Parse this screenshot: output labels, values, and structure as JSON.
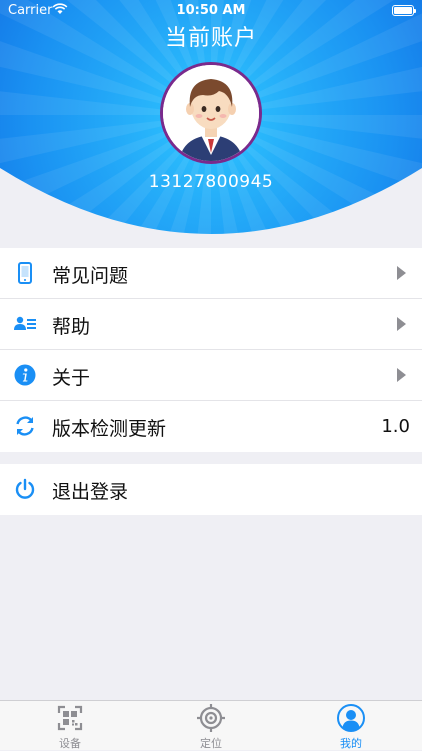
{
  "status_bar": {
    "carrier": "Carrier",
    "time": "10:50 AM"
  },
  "header": {
    "title": "当前账户",
    "phone": "13127800945"
  },
  "menu": {
    "items": [
      {
        "label": "常见问题",
        "icon": "phone-icon"
      },
      {
        "label": "帮助",
        "icon": "contacts-icon"
      },
      {
        "label": "关于",
        "icon": "info-icon"
      },
      {
        "label": "版本检测更新",
        "icon": "refresh-icon",
        "value": "1.0"
      }
    ],
    "logout": {
      "label": "退出登录",
      "icon": "power-icon"
    }
  },
  "tabbar": {
    "tabs": [
      {
        "label": "设备",
        "icon": "qr-scan-icon"
      },
      {
        "label": "定位",
        "icon": "target-icon"
      },
      {
        "label": "我的",
        "icon": "user-icon",
        "active": true
      }
    ]
  },
  "colors": {
    "accent": "#1a8ff5",
    "header_light": "#2ec2ff",
    "header_dark": "#1273e6"
  }
}
